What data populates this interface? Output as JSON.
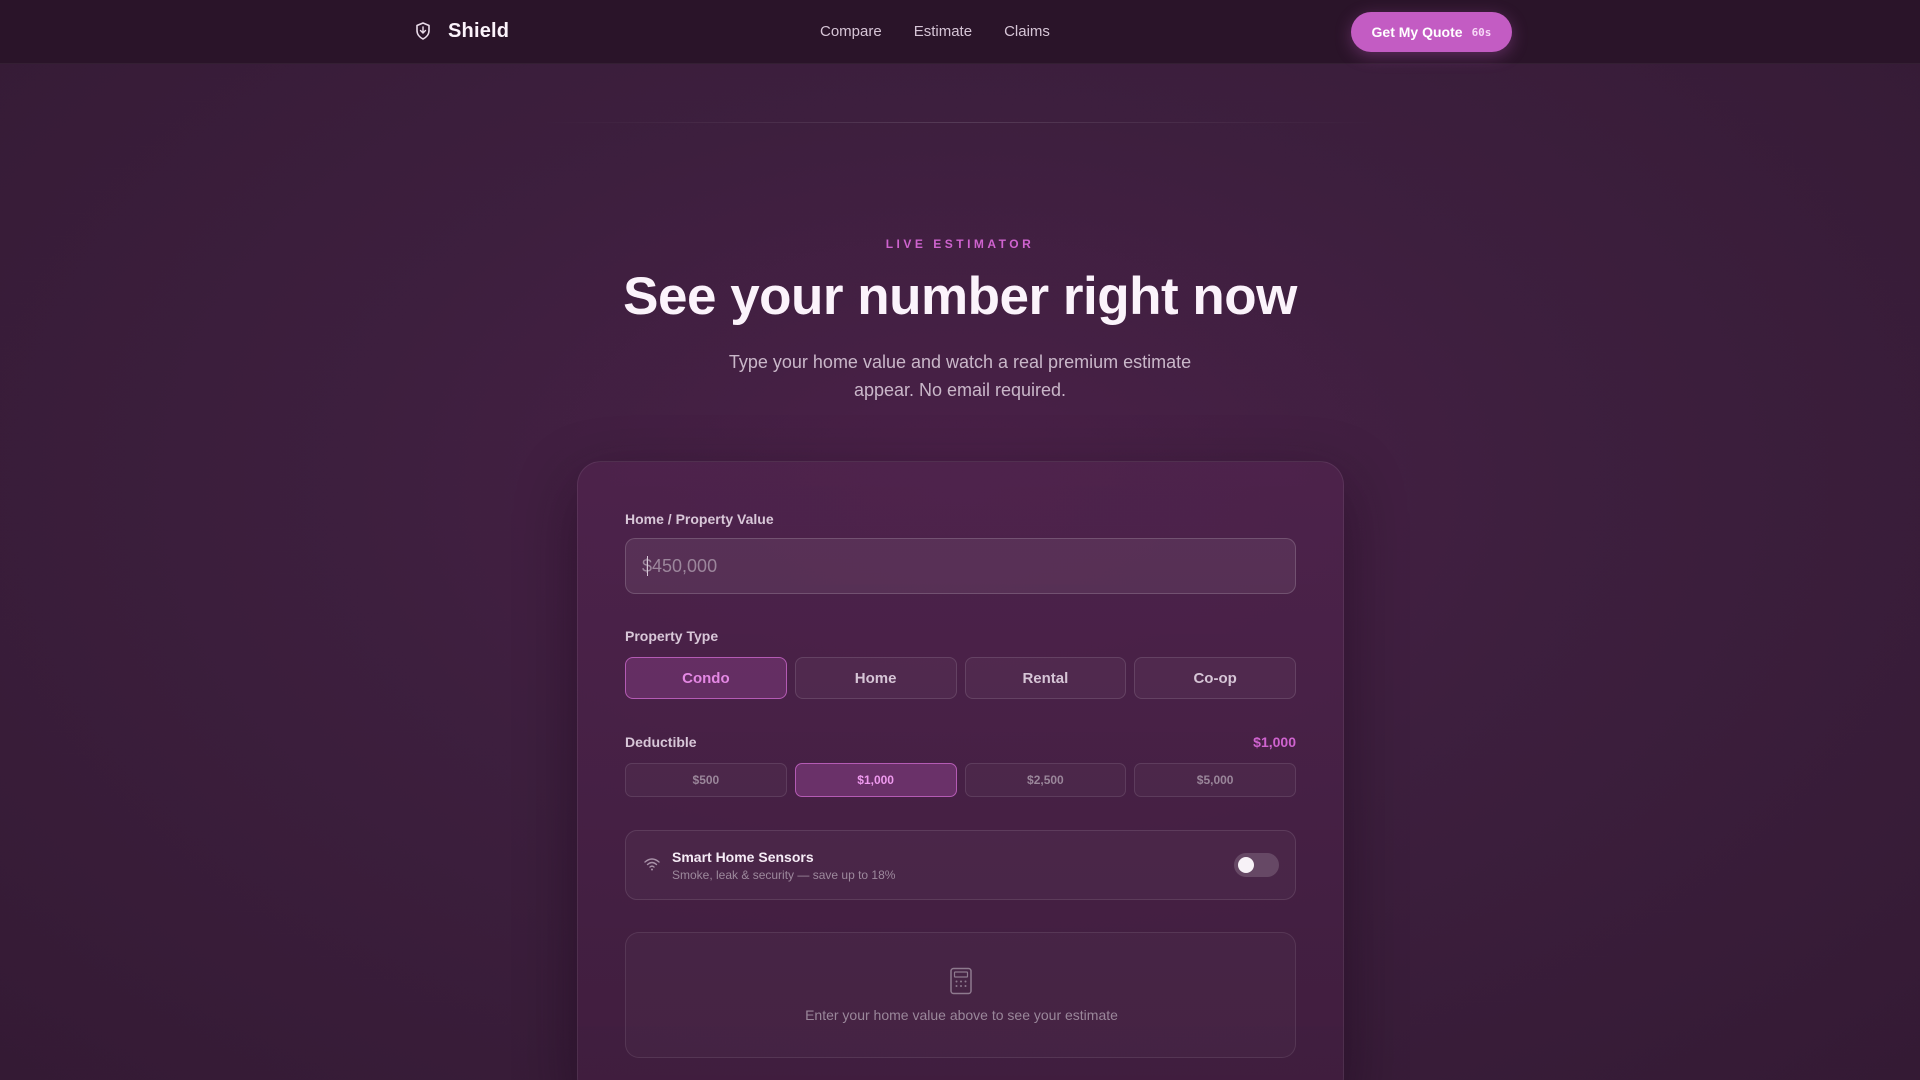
{
  "nav": {
    "brand": "Shield",
    "brand_icon": "shield-icon",
    "links": [
      "Compare",
      "Estimate",
      "Claims"
    ],
    "cta_label": "Get My Quote",
    "cta_timer": "60s"
  },
  "hero": {
    "eyebrow": "LIVE ESTIMATOR",
    "title": "See your number right now",
    "subtitle": "Type your home value and watch a real premium estimate appear. No email required."
  },
  "form": {
    "value_label": "Home / Property Value",
    "value_placeholder": "$450,000",
    "value_current": "",
    "type_label": "Property Type",
    "types": [
      "Condo",
      "Home",
      "Rental",
      "Co-op"
    ],
    "type_selected": "Condo",
    "deductible_label": "Deductible",
    "deductible_value": "$1,000",
    "deductibles": [
      "$500",
      "$1,000",
      "$2,500",
      "$5,000"
    ],
    "deductible_selected": "$1,000",
    "sensors": {
      "icon": "wifi-icon",
      "title": "Smart Home Sensors",
      "subtitle": "Smoke, leak & security — save up to 18%",
      "enabled": false
    },
    "estimate": {
      "icon": "calculator-icon",
      "empty_text": "Enter your home value above to see your estimate"
    }
  },
  "colors": {
    "accent": "#c35cc3",
    "accent_text": "#cf63cf",
    "background": "#3d1f3e",
    "nav_background": "#2a1429"
  }
}
